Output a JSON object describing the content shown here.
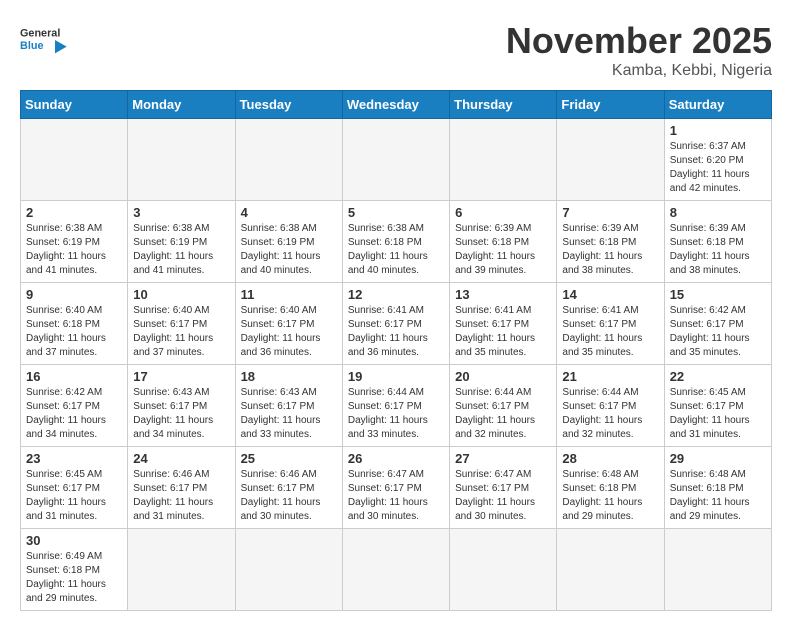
{
  "header": {
    "logo_text_general": "General",
    "logo_text_blue": "Blue",
    "month_title": "November 2025",
    "location": "Kamba, Kebbi, Nigeria"
  },
  "calendar": {
    "days_of_week": [
      "Sunday",
      "Monday",
      "Tuesday",
      "Wednesday",
      "Thursday",
      "Friday",
      "Saturday"
    ],
    "weeks": [
      [
        {
          "day": "",
          "info": ""
        },
        {
          "day": "",
          "info": ""
        },
        {
          "day": "",
          "info": ""
        },
        {
          "day": "",
          "info": ""
        },
        {
          "day": "",
          "info": ""
        },
        {
          "day": "",
          "info": ""
        },
        {
          "day": "1",
          "info": "Sunrise: 6:37 AM\nSunset: 6:20 PM\nDaylight: 11 hours and 42 minutes."
        }
      ],
      [
        {
          "day": "2",
          "info": "Sunrise: 6:38 AM\nSunset: 6:19 PM\nDaylight: 11 hours and 41 minutes."
        },
        {
          "day": "3",
          "info": "Sunrise: 6:38 AM\nSunset: 6:19 PM\nDaylight: 11 hours and 41 minutes."
        },
        {
          "day": "4",
          "info": "Sunrise: 6:38 AM\nSunset: 6:19 PM\nDaylight: 11 hours and 40 minutes."
        },
        {
          "day": "5",
          "info": "Sunrise: 6:38 AM\nSunset: 6:18 PM\nDaylight: 11 hours and 40 minutes."
        },
        {
          "day": "6",
          "info": "Sunrise: 6:39 AM\nSunset: 6:18 PM\nDaylight: 11 hours and 39 minutes."
        },
        {
          "day": "7",
          "info": "Sunrise: 6:39 AM\nSunset: 6:18 PM\nDaylight: 11 hours and 38 minutes."
        },
        {
          "day": "8",
          "info": "Sunrise: 6:39 AM\nSunset: 6:18 PM\nDaylight: 11 hours and 38 minutes."
        }
      ],
      [
        {
          "day": "9",
          "info": "Sunrise: 6:40 AM\nSunset: 6:18 PM\nDaylight: 11 hours and 37 minutes."
        },
        {
          "day": "10",
          "info": "Sunrise: 6:40 AM\nSunset: 6:17 PM\nDaylight: 11 hours and 37 minutes."
        },
        {
          "day": "11",
          "info": "Sunrise: 6:40 AM\nSunset: 6:17 PM\nDaylight: 11 hours and 36 minutes."
        },
        {
          "day": "12",
          "info": "Sunrise: 6:41 AM\nSunset: 6:17 PM\nDaylight: 11 hours and 36 minutes."
        },
        {
          "day": "13",
          "info": "Sunrise: 6:41 AM\nSunset: 6:17 PM\nDaylight: 11 hours and 35 minutes."
        },
        {
          "day": "14",
          "info": "Sunrise: 6:41 AM\nSunset: 6:17 PM\nDaylight: 11 hours and 35 minutes."
        },
        {
          "day": "15",
          "info": "Sunrise: 6:42 AM\nSunset: 6:17 PM\nDaylight: 11 hours and 35 minutes."
        }
      ],
      [
        {
          "day": "16",
          "info": "Sunrise: 6:42 AM\nSunset: 6:17 PM\nDaylight: 11 hours and 34 minutes."
        },
        {
          "day": "17",
          "info": "Sunrise: 6:43 AM\nSunset: 6:17 PM\nDaylight: 11 hours and 34 minutes."
        },
        {
          "day": "18",
          "info": "Sunrise: 6:43 AM\nSunset: 6:17 PM\nDaylight: 11 hours and 33 minutes."
        },
        {
          "day": "19",
          "info": "Sunrise: 6:44 AM\nSunset: 6:17 PM\nDaylight: 11 hours and 33 minutes."
        },
        {
          "day": "20",
          "info": "Sunrise: 6:44 AM\nSunset: 6:17 PM\nDaylight: 11 hours and 32 minutes."
        },
        {
          "day": "21",
          "info": "Sunrise: 6:44 AM\nSunset: 6:17 PM\nDaylight: 11 hours and 32 minutes."
        },
        {
          "day": "22",
          "info": "Sunrise: 6:45 AM\nSunset: 6:17 PM\nDaylight: 11 hours and 31 minutes."
        }
      ],
      [
        {
          "day": "23",
          "info": "Sunrise: 6:45 AM\nSunset: 6:17 PM\nDaylight: 11 hours and 31 minutes."
        },
        {
          "day": "24",
          "info": "Sunrise: 6:46 AM\nSunset: 6:17 PM\nDaylight: 11 hours and 31 minutes."
        },
        {
          "day": "25",
          "info": "Sunrise: 6:46 AM\nSunset: 6:17 PM\nDaylight: 11 hours and 30 minutes."
        },
        {
          "day": "26",
          "info": "Sunrise: 6:47 AM\nSunset: 6:17 PM\nDaylight: 11 hours and 30 minutes."
        },
        {
          "day": "27",
          "info": "Sunrise: 6:47 AM\nSunset: 6:17 PM\nDaylight: 11 hours and 30 minutes."
        },
        {
          "day": "28",
          "info": "Sunrise: 6:48 AM\nSunset: 6:18 PM\nDaylight: 11 hours and 29 minutes."
        },
        {
          "day": "29",
          "info": "Sunrise: 6:48 AM\nSunset: 6:18 PM\nDaylight: 11 hours and 29 minutes."
        }
      ],
      [
        {
          "day": "30",
          "info": "Sunrise: 6:49 AM\nSunset: 6:18 PM\nDaylight: 11 hours and 29 minutes."
        },
        {
          "day": "",
          "info": ""
        },
        {
          "day": "",
          "info": ""
        },
        {
          "day": "",
          "info": ""
        },
        {
          "day": "",
          "info": ""
        },
        {
          "day": "",
          "info": ""
        },
        {
          "day": "",
          "info": ""
        }
      ]
    ]
  }
}
